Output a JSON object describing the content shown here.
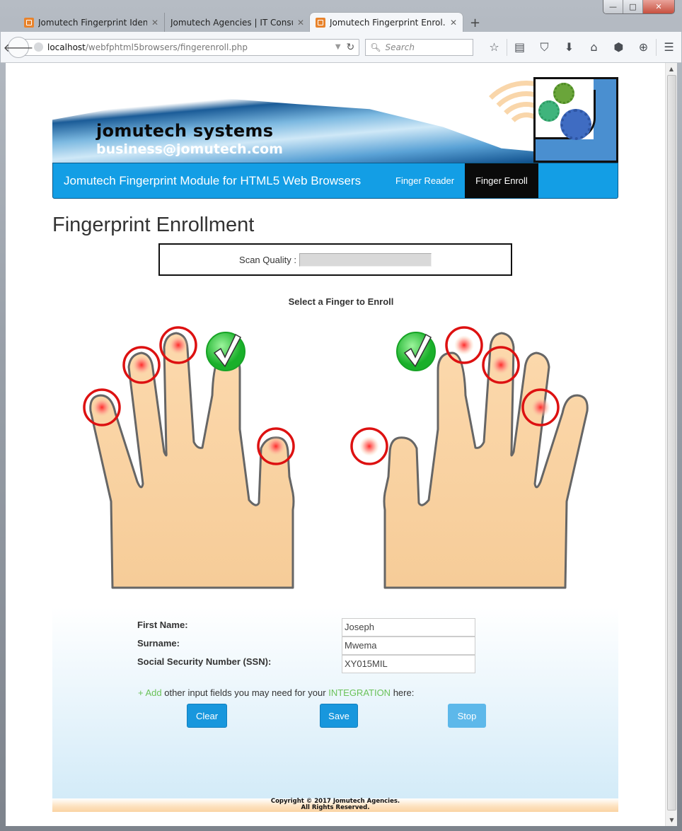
{
  "window": {
    "controls": {
      "minimize": "—",
      "maximize": "□",
      "close": "✕"
    }
  },
  "tabs": [
    {
      "title": "Jomutech Fingerprint Ident...",
      "active": false
    },
    {
      "title": "Jomutech Agencies | IT Consul...",
      "active": false
    },
    {
      "title": "Jomutech Fingerprint Enrol...",
      "active": true
    }
  ],
  "toolbar": {
    "url_host": "localhost",
    "url_path": "/webfphtml5browsers/fingerenroll.php",
    "search_placeholder": "Search",
    "icons": [
      "bookmark-star-icon",
      "reading-list-icon",
      "pocket-icon",
      "download-icon",
      "home-icon",
      "privacy-eye-icon",
      "web-developer-icon",
      "menu-icon"
    ]
  },
  "banner": {
    "title": "jomutech systems",
    "email": "business@jomutech.com"
  },
  "nav": {
    "brand": "Jomutech Fingerprint Module for HTML5 Web Browsers",
    "links": [
      {
        "label": "Finger Reader",
        "active": false
      },
      {
        "label": "Finger Enroll",
        "active": true
      }
    ]
  },
  "page": {
    "title": "Fingerprint Enrollment",
    "scan_quality_label": "Scan Quality :",
    "scan_quality_value": 0,
    "select_finger_label": "Select a Finger to Enroll"
  },
  "fingers": {
    "left_hand": [
      {
        "finger": "little",
        "status": "pending"
      },
      {
        "finger": "ring",
        "status": "pending"
      },
      {
        "finger": "middle",
        "status": "pending"
      },
      {
        "finger": "index",
        "status": "enrolled"
      },
      {
        "finger": "thumb",
        "status": "pending"
      }
    ],
    "right_hand": [
      {
        "finger": "thumb",
        "status": "pending"
      },
      {
        "finger": "index",
        "status": "enrolled"
      },
      {
        "finger": "middle",
        "status": "pending"
      },
      {
        "finger": "ring",
        "status": "pending"
      },
      {
        "finger": "little",
        "status": "pending"
      }
    ]
  },
  "form": {
    "fields": [
      {
        "label": "First Name:",
        "value": "Joseph"
      },
      {
        "label": "Surname:",
        "value": "Mwema"
      },
      {
        "label": "Social Security Number (SSN):",
        "value": "XY015MIL"
      }
    ],
    "hint": {
      "add": "+ Add",
      "middle": " other input fields you may need for your ",
      "integration": "INTEGRATION",
      "end": " here:"
    },
    "buttons": {
      "clear": "Clear",
      "save": "Save",
      "stop": "Stop"
    }
  },
  "footer": {
    "line1": "Copyright © 2017 Jomutech Agencies.",
    "line2": "All Rights Reserved."
  },
  "colors": {
    "nav_bg": "#139ee5",
    "nav_active_bg": "#0a0a0a",
    "button": "#1897dd",
    "button_disabled": "#5db8ea",
    "hint_green": "#6ac259",
    "pending_ring": "#dd1111",
    "enrolled_check": "#2bc93a"
  }
}
